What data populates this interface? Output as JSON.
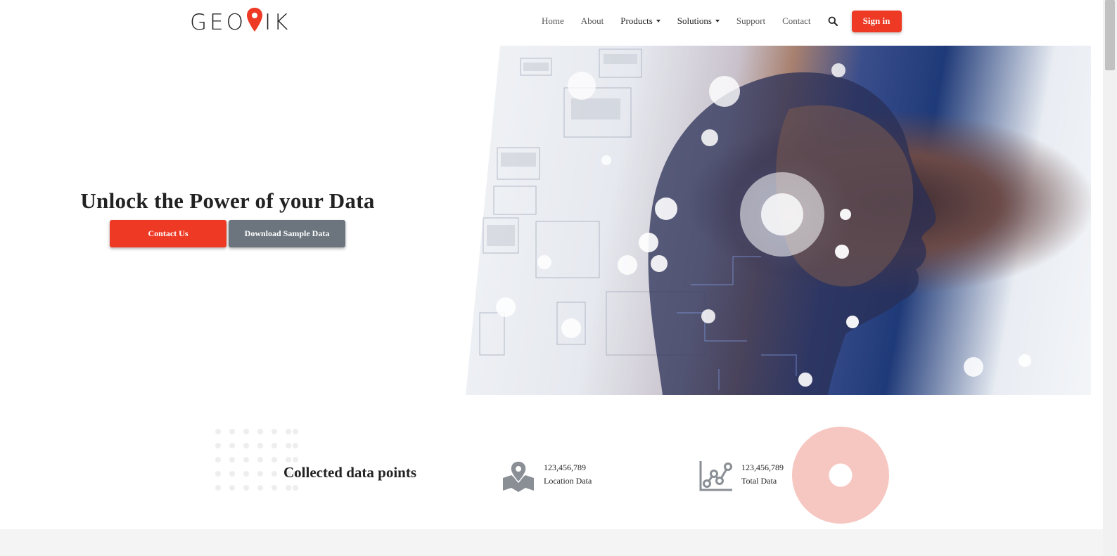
{
  "brand": {
    "logo_left": "GEO",
    "logo_right": "IK",
    "accent_color": "#ee3a24",
    "gray_button_color": "#6c757d"
  },
  "nav": {
    "items": [
      {
        "label": "Home",
        "dropdown": false
      },
      {
        "label": "About",
        "dropdown": false
      },
      {
        "label": "Products",
        "dropdown": true
      },
      {
        "label": "Solutions",
        "dropdown": true
      },
      {
        "label": "Support",
        "dropdown": false
      },
      {
        "label": "Contact",
        "dropdown": false
      }
    ],
    "search_icon": "search-icon",
    "signin_label": "Sign in"
  },
  "hero": {
    "title": "Unlock the Power of your Data",
    "contact_label": "Contact Us",
    "download_label": "Download Sample Data"
  },
  "stats": {
    "title": "Collected data points",
    "items": [
      {
        "value": "123,456,789",
        "label": "Location Data",
        "icon": "map-pin-icon"
      },
      {
        "value": "123,456,789",
        "label": "Total Data",
        "icon": "line-chart-icon"
      }
    ]
  }
}
